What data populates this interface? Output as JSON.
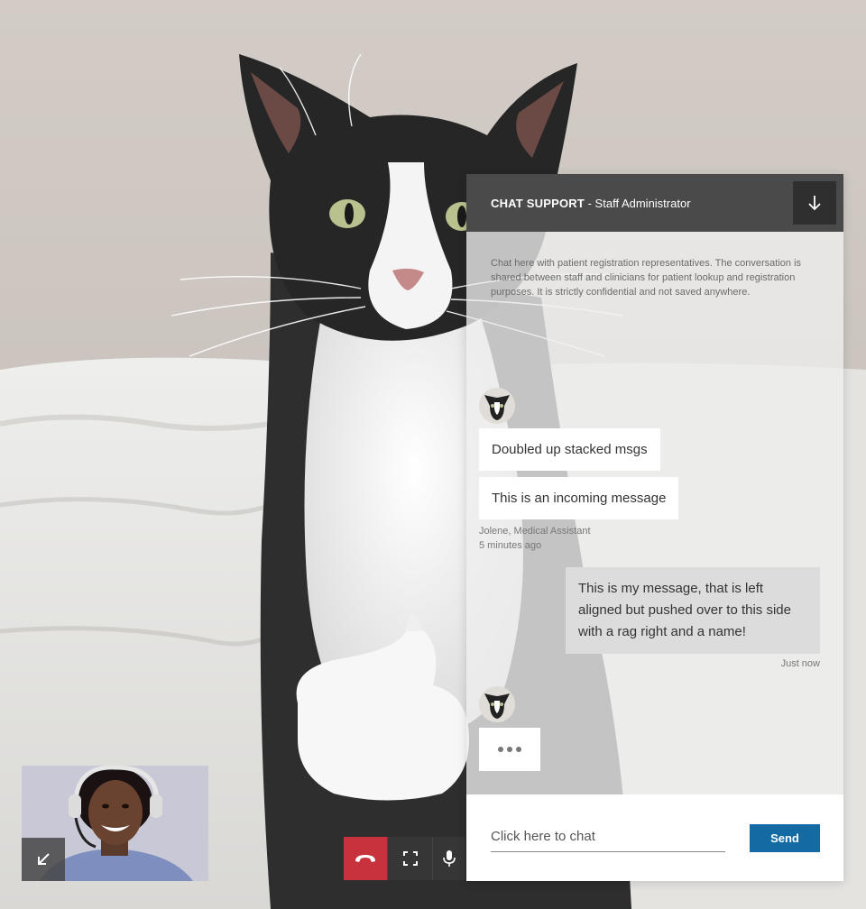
{
  "video": {
    "background_image": "cat-thumbs-up-photo",
    "self_view_image": "agent-with-headset-photo"
  },
  "controls": {
    "minimize_icon": "arrow-down-left-icon",
    "hangup_icon": "phone-hangup-icon",
    "fullscreen_icon": "fullscreen-icon",
    "mic_icon": "microphone-icon",
    "hangup_color": "#c8323c"
  },
  "chat": {
    "header": {
      "title_strong": "CHAT SUPPORT",
      "title_rest": " - Staff Administrator",
      "collapse_icon": "arrow-down-icon"
    },
    "intro": "Chat here with patient registration representatives. The conversation is shared between staff and clinicians for patient lookup and registration purposes. It is strictly confidential and not saved anywhere.",
    "incoming": [
      {
        "text": "Doubled up stacked msgs"
      },
      {
        "text": "This is an incoming message"
      }
    ],
    "incoming_sender": "Jolene, Medical Assistant",
    "incoming_time": "5 minutes ago",
    "outgoing": {
      "text": "This is my message, that is left aligned but pushed over to this side with a rag right and a name!",
      "time": "Just now"
    },
    "input": {
      "placeholder": "Click here to chat",
      "value": ""
    },
    "send_label": "Send",
    "accent": "#146ba3"
  }
}
